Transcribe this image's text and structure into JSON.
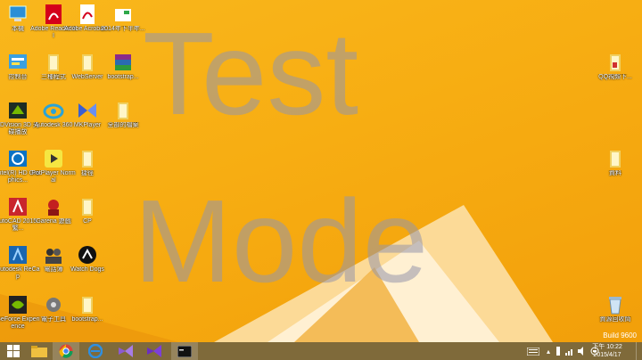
{
  "watermark": {
    "line1": "Test",
    "line2": "Mode"
  },
  "build_text": "Build 9600",
  "desktop": {
    "icons": [
      {
        "label": "本機",
        "icon": "computer-icon"
      },
      {
        "label": "Adobe Reader XI",
        "icon": "pdf-icon"
      },
      {
        "label": "Adobe Acrobat...",
        "icon": "pdf-doc-icon"
      },
      {
        "label": "2014年下半年...",
        "icon": "document-icon"
      },
      {
        "label": "控制台",
        "icon": "control-panel-icon"
      },
      {
        "label": "三種程式",
        "icon": "folder-icon"
      },
      {
        "label": "WebServer",
        "icon": "folder-icon"
      },
      {
        "label": "bootstrap...",
        "icon": "archive-icon"
      },
      {
        "label": "3DVision 3D 光碟播放",
        "icon": "3d-vision-icon"
      },
      {
        "label": "Autodesk 360",
        "icon": "autodesk-360-icon"
      },
      {
        "label": "MKPlayer",
        "icon": "player-icon"
      },
      {
        "label": "全部的檔案",
        "icon": "folder-icon"
      },
      {
        "label": "Intel(R) HD Graphics...",
        "icon": "intel-graphics-icon"
      },
      {
        "label": "PotPlayer Normal",
        "icon": "potplayer-icon"
      },
      {
        "label": "捷徑",
        "icon": "folder-icon"
      },
      {
        "label": "AutoCAD 2015 - 繁...",
        "icon": "autocad-icon"
      },
      {
        "label": "Garena 遊戲",
        "icon": "garena-icon"
      },
      {
        "label": "CP",
        "icon": "folder-icon"
      },
      {
        "label": "Autodesk ReCap",
        "icon": "recap-icon"
      },
      {
        "label": "電話簿",
        "icon": "contacts-icon"
      },
      {
        "label": "Watch Dogs",
        "icon": "watch-dogs-icon"
      },
      {
        "label": "GeForce Experience",
        "icon": "geforce-icon"
      },
      {
        "label": "電子工具",
        "icon": "tools-icon"
      },
      {
        "label": "bootstrap...",
        "icon": "folder-icon"
      }
    ],
    "right_icons": [
      {
        "label": "QQ視頻下...",
        "icon": "folder-icon"
      },
      {
        "label": "資料",
        "icon": "folder-icon"
      },
      {
        "label": "資源回收筒",
        "icon": "recycle-bin-icon"
      }
    ]
  },
  "taskbar": {
    "buttons": [
      {
        "name": "start-button",
        "icon": "windows-icon"
      },
      {
        "name": "file-explorer",
        "icon": "folder-icon"
      },
      {
        "name": "chrome",
        "icon": "chrome-icon"
      },
      {
        "name": "internet-explorer",
        "icon": "ie-icon"
      },
      {
        "name": "visual-studio-1",
        "icon": "visual-studio-icon"
      },
      {
        "name": "visual-studio-2",
        "icon": "visual-studio-icon"
      },
      {
        "name": "command-prompt",
        "icon": "cmd-icon"
      }
    ],
    "clock": {
      "time": "下午 10:22",
      "date": "2015/4/17"
    }
  },
  "colors": {
    "accent": "#f7ad12",
    "taskbar": "#7f6a3a"
  }
}
